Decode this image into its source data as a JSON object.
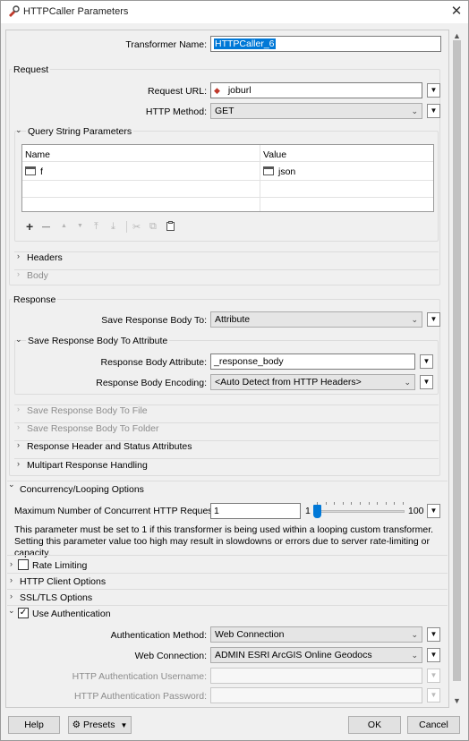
{
  "window": {
    "title": "HTTPCaller Parameters"
  },
  "transformer_name": {
    "label": "Transformer Name:",
    "value": "HTTPCaller_6"
  },
  "request": {
    "title": "Request",
    "url_label": "Request URL:",
    "url_value": "joburl",
    "method_label": "HTTP Method:",
    "method_value": "GET",
    "qs": {
      "title": "Query String Parameters",
      "col_name": "Name",
      "col_value": "Value",
      "rows": [
        {
          "name": "f",
          "value": "json"
        }
      ]
    },
    "headers_label": "Headers",
    "body_label": "Body"
  },
  "response": {
    "title": "Response",
    "save_label": "Save Response Body To:",
    "save_value": "Attribute",
    "attr_group": {
      "title": "Save Response Body To Attribute",
      "attr_label": "Response Body Attribute:",
      "attr_value": "_response_body",
      "enc_label": "Response Body Encoding:",
      "enc_value": "<Auto Detect from HTTP Headers>"
    },
    "to_file": "Save Response Body To File",
    "to_folder": "Save Response Body To Folder",
    "header_status": "Response Header and Status Attributes",
    "multipart": "Multipart Response Handling"
  },
  "concurrency": {
    "title": "Concurrency/Looping Options",
    "max_label": "Maximum Number of Concurrent HTTP Requests:",
    "max_value": "1",
    "slider_min": "1",
    "slider_max": "100",
    "slider_level": 0.0,
    "note": "This parameter must be set to 1 if this transformer is being used within a looping custom transformer. Setting this parameter value too high may result in slowdowns or errors due to server rate-limiting or capacity."
  },
  "rate_limiting": {
    "label": "Rate Limiting",
    "checked": false
  },
  "http_client": "HTTP Client Options",
  "ssl": "SSL/TLS Options",
  "auth": {
    "label": "Use Authentication",
    "checked": true,
    "check_mark": "✓",
    "method_label": "Authentication Method:",
    "method_value": "Web Connection",
    "conn_label": "Web Connection:",
    "conn_value": "ADMIN ESRI ArcGIS Online Geodocs",
    "user_label": "HTTP Authentication Username:",
    "pass_label": "HTTP Authentication Password:"
  },
  "buttons": {
    "help": "Help",
    "presets": "Presets",
    "ok": "OK",
    "cancel": "Cancel"
  },
  "icons": {
    "close": "✕",
    "chevron_down": "⌄",
    "expanded": "⌄",
    "collapsed": "›",
    "menu_arrow": "▼",
    "attr_icon": "◆",
    "add": "+",
    "remove": "—",
    "up": "▲",
    "down": "▼",
    "top": "⤒",
    "bottom": "⤓",
    "cut": "✂",
    "copy": "⧉",
    "paste": "📋"
  }
}
